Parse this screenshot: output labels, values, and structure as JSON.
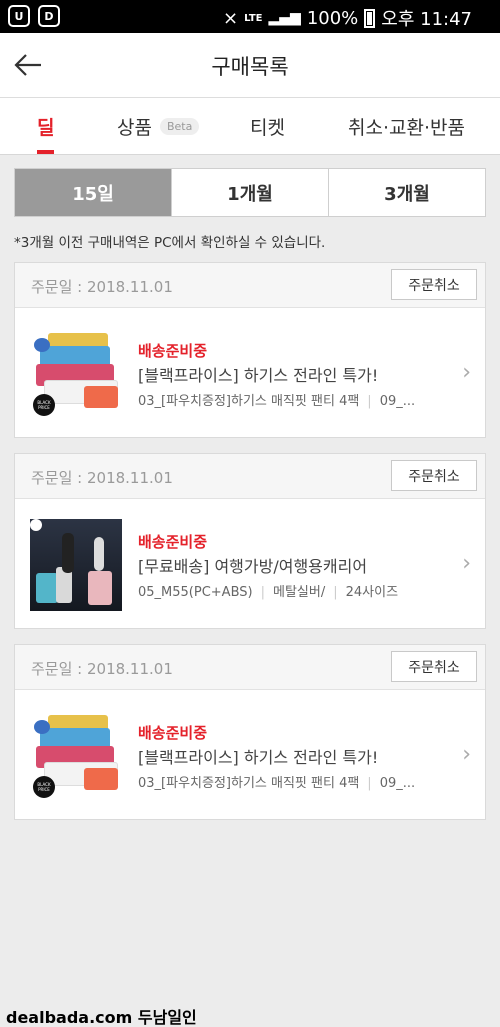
{
  "status_bar": {
    "network": "LTE",
    "battery": "100%",
    "time": "오후 11:47",
    "app_icon_1": "U",
    "app_icon_2": "D"
  },
  "header": {
    "title": "구매목록",
    "back_icon": "arrow-left-icon"
  },
  "tabs": [
    {
      "label": "딜",
      "active": true
    },
    {
      "label": "상품",
      "badge": "Beta"
    },
    {
      "label": "티켓"
    },
    {
      "label": "취소·교환·반품"
    }
  ],
  "periods": [
    {
      "label": "15일",
      "active": true
    },
    {
      "label": "1개월"
    },
    {
      "label": "3개월"
    }
  ],
  "notice": "*3개월 이전 구매내역은 PC에서 확인하실 수 있습니다.",
  "orders": [
    {
      "date": "주문일 : 2018.11.01",
      "cancel_label": "주문취소",
      "status": "배송준비중",
      "product": "[블랙프라이스] 하기스 전라인 특가!",
      "options": [
        "03_[파우치증정]하기스 매직핏 팬티 4팩",
        "09_..."
      ],
      "thumb": "diapers",
      "badge_text": "BLACK PRICE"
    },
    {
      "date": "주문일 : 2018.11.01",
      "cancel_label": "주문취소",
      "status": "배송준비중",
      "product": "[무료배송] 여행가방/여행용캐리어",
      "options": [
        "05_M55(PC+ABS)",
        "메탈실버/",
        "24사이즈"
      ],
      "thumb": "luggage"
    },
    {
      "date": "주문일 : 2018.11.01",
      "cancel_label": "주문취소",
      "status": "배송준비중",
      "product": "[블랙프라이스] 하기스 전라인 특가!",
      "options": [
        "03_[파우치증정]하기스 매직핏 팬티 4팩",
        "09_..."
      ],
      "thumb": "diapers",
      "badge_text": "BLACK PRICE"
    }
  ],
  "watermark": "dealbada.com  두남일인",
  "colors": {
    "accent": "#e4212a",
    "active_period": "#9a9a9a"
  }
}
